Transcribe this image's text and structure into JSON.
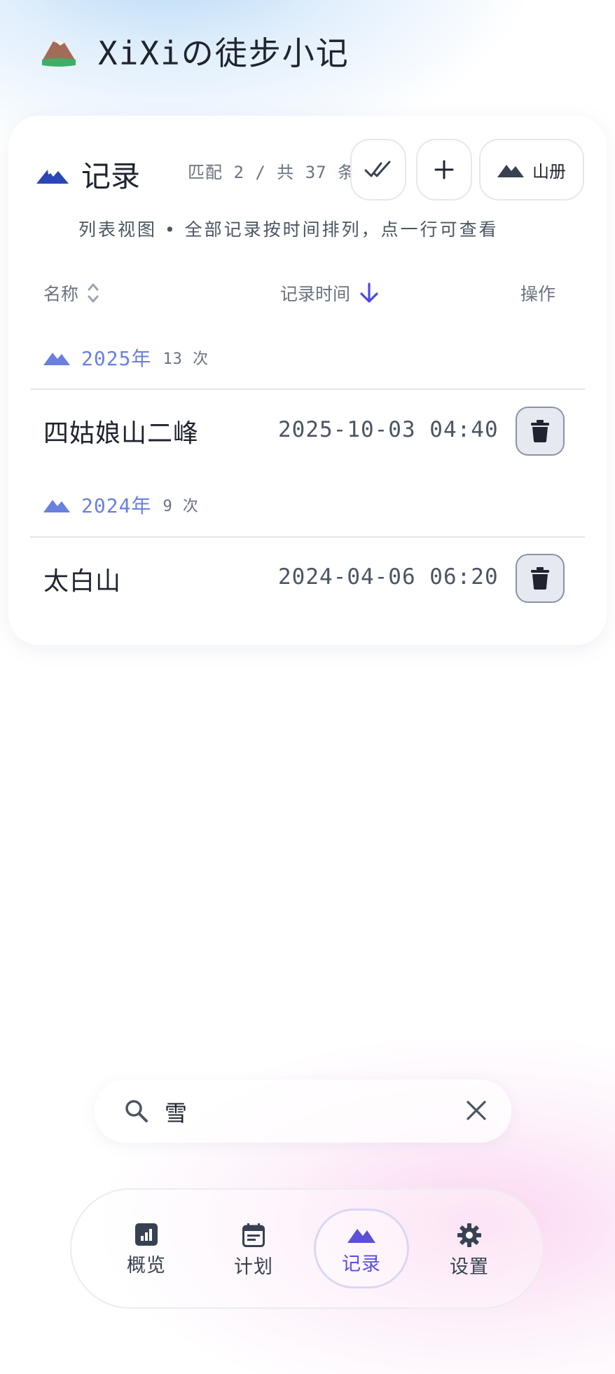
{
  "app": {
    "title": "XiXiの徒步小记",
    "logo_icon": "mountain-logo"
  },
  "records": {
    "title": "记录",
    "match_text": "匹配 2 / 共 37 条",
    "book_button_label": "山册",
    "view_hint": "列表视图 • 全部记录按时间排列，点一行可查看",
    "columns": {
      "name": "名称",
      "time": "记录时间",
      "ops": "操作"
    },
    "groups": [
      {
        "year": "2025年",
        "count": "13 次",
        "items": [
          {
            "name": "四姑娘山二峰",
            "time": "2025-10-03 04:40"
          }
        ]
      },
      {
        "year": "2024年",
        "count": "9 次",
        "items": [
          {
            "name": "太白山",
            "time": "2024-04-06 06:20"
          }
        ]
      }
    ]
  },
  "search": {
    "value": "雪"
  },
  "nav": {
    "items": [
      {
        "label": "概览",
        "icon": "chart-icon"
      },
      {
        "label": "计划",
        "icon": "calendar-icon"
      },
      {
        "label": "记录",
        "icon": "mountain-icon",
        "active": true
      },
      {
        "label": "设置",
        "icon": "gear-icon"
      }
    ]
  },
  "colors": {
    "accent": "#5b4fd9",
    "group_year": "#6a7fe0",
    "title_icon": "#2b46b5"
  }
}
